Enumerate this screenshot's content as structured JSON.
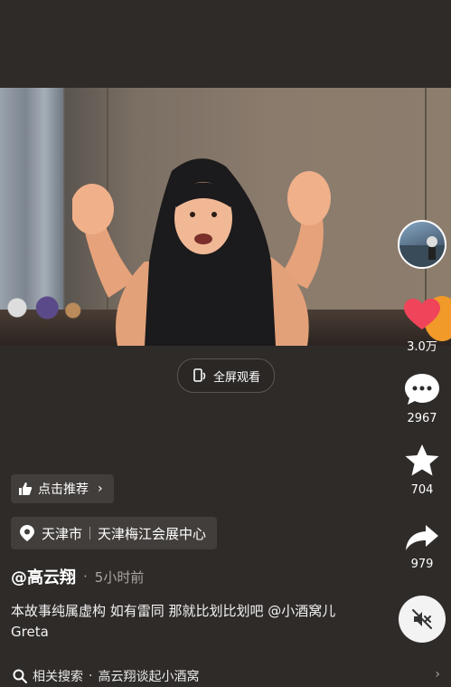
{
  "video": {
    "fullscreen_label": "全屏观看"
  },
  "sidebar": {
    "like_count": "3.0万",
    "comment_count": "2967",
    "favorite_count": "704",
    "share_count": "979",
    "like_color": "#f0445a"
  },
  "recommend": {
    "label": "点击推荐"
  },
  "location": {
    "city": "天津市",
    "place": "天津梅江会展中心"
  },
  "post": {
    "author": "@高云翔",
    "time_sep": "·",
    "time": "5小时前",
    "caption": "本故事纯属虚构 如有雷同 那就比划比划吧 @小酒窝儿Greta"
  },
  "related": {
    "label": "相关搜索",
    "sep": "·",
    "query": "高云翔谈起小酒窝"
  }
}
